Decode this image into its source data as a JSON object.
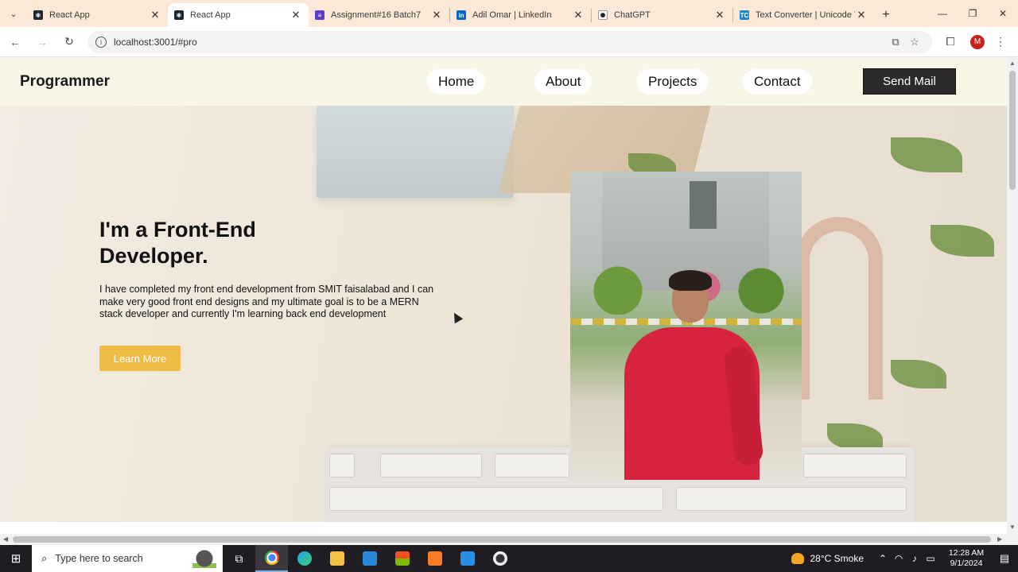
{
  "browser": {
    "tabs": [
      {
        "title": "React App",
        "favicon_color": "#1b2833",
        "favicon_glyph": "⚛",
        "active": false
      },
      {
        "title": "React App",
        "favicon_color": "#1b2833",
        "favicon_glyph": "⚛",
        "active": true
      },
      {
        "title": "Assignment#16 Batch7",
        "favicon_color": "#5b3fc4",
        "favicon_glyph": "≡",
        "active": false
      },
      {
        "title": "Adil Omar | LinkedIn",
        "favicon_color": "#0a66c2",
        "favicon_glyph": "in",
        "active": false
      },
      {
        "title": "ChatGPT",
        "favicon_color": "#ffffff",
        "favicon_glyph": "✺",
        "active": false
      },
      {
        "title": "Text Converter | Unicode T",
        "favicon_color": "#1e88c7",
        "favicon_glyph": "TC",
        "active": false
      }
    ],
    "close_glyph": "✕",
    "newtab_glyph": "+",
    "url": "localhost:3001/#pro",
    "profile_initial": "M"
  },
  "site": {
    "brand": "Programmer",
    "nav": [
      "Home",
      "About",
      "Projects",
      "Contact"
    ],
    "cta": "Send Mail",
    "hero": {
      "title": "I'm a Front-End Developer.",
      "text": "I have completed my front end development from SMIT faisalabad and I can make very good front end designs and my ultimate goal is to be a MERN stack developer and currently I'm learning back end development",
      "button": "Learn More"
    },
    "colors": {
      "accent": "#f0bd44",
      "cta_bg": "#2b2b2b",
      "header_bg": "#f8f6e6"
    }
  },
  "taskbar": {
    "search_placeholder": "Type here to search",
    "weather": "28°C Smoke",
    "time": "12:28 AM",
    "date": "9/1/2024"
  }
}
